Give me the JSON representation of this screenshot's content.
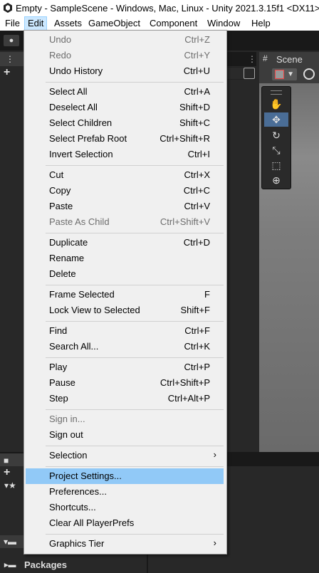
{
  "window": {
    "title": "Empty - SampleScene - Windows, Mac, Linux - Unity 2021.3.15f1 <DX11>",
    "logo_icon": "unity-logo-icon"
  },
  "menubar": [
    "File",
    "Edit",
    "Assets",
    "GameObject",
    "Component",
    "Window",
    "Help"
  ],
  "menubar_active": "Edit",
  "scene": {
    "tab_label": "Scene"
  },
  "bottom": {
    "packages_label": "Packages"
  },
  "edit_menu": {
    "items": [
      {
        "label": "Undo",
        "shortcut": "Ctrl+Z",
        "enabled": false
      },
      {
        "label": "Redo",
        "shortcut": "Ctrl+Y",
        "enabled": false
      },
      {
        "label": "Undo History",
        "shortcut": "Ctrl+U",
        "enabled": true
      },
      {
        "label": "Select All",
        "shortcut": "Ctrl+A",
        "enabled": true
      },
      {
        "label": "Deselect All",
        "shortcut": "Shift+D",
        "enabled": true
      },
      {
        "label": "Select Children",
        "shortcut": "Shift+C",
        "enabled": true
      },
      {
        "label": "Select Prefab Root",
        "shortcut": "Ctrl+Shift+R",
        "enabled": true
      },
      {
        "label": "Invert Selection",
        "shortcut": "Ctrl+I",
        "enabled": true
      },
      {
        "label": "Cut",
        "shortcut": "Ctrl+X",
        "enabled": true
      },
      {
        "label": "Copy",
        "shortcut": "Ctrl+C",
        "enabled": true
      },
      {
        "label": "Paste",
        "shortcut": "Ctrl+V",
        "enabled": true
      },
      {
        "label": "Paste As Child",
        "shortcut": "Ctrl+Shift+V",
        "enabled": false
      },
      {
        "label": "Duplicate",
        "shortcut": "Ctrl+D",
        "enabled": true
      },
      {
        "label": "Rename",
        "shortcut": "",
        "enabled": true
      },
      {
        "label": "Delete",
        "shortcut": "",
        "enabled": true
      },
      {
        "label": "Frame Selected",
        "shortcut": "F",
        "enabled": true
      },
      {
        "label": "Lock View to Selected",
        "shortcut": "Shift+F",
        "enabled": true
      },
      {
        "label": "Find",
        "shortcut": "Ctrl+F",
        "enabled": true
      },
      {
        "label": "Search All...",
        "shortcut": "Ctrl+K",
        "enabled": true
      },
      {
        "label": "Play",
        "shortcut": "Ctrl+P",
        "enabled": true
      },
      {
        "label": "Pause",
        "shortcut": "Ctrl+Shift+P",
        "enabled": true
      },
      {
        "label": "Step",
        "shortcut": "Ctrl+Alt+P",
        "enabled": true
      },
      {
        "label": "Sign in...",
        "shortcut": "",
        "enabled": false
      },
      {
        "label": "Sign out",
        "shortcut": "",
        "enabled": true
      },
      {
        "label": "Selection",
        "shortcut": "",
        "enabled": true,
        "submenu": true
      },
      {
        "label": "Project Settings...",
        "shortcut": "",
        "enabled": true,
        "highlighted": true
      },
      {
        "label": "Preferences...",
        "shortcut": "",
        "enabled": true
      },
      {
        "label": "Shortcuts...",
        "shortcut": "",
        "enabled": true
      },
      {
        "label": "Clear All PlayerPrefs",
        "shortcut": "",
        "enabled": true
      },
      {
        "label": "Graphics Tier",
        "shortcut": "",
        "enabled": true,
        "submenu": true
      }
    ],
    "highlight_color": "#91c9f7"
  },
  "colors": {
    "editor_bg": "#282828",
    "menu_bg": "#f0f0f0",
    "active_tool": "#4a6d96"
  }
}
